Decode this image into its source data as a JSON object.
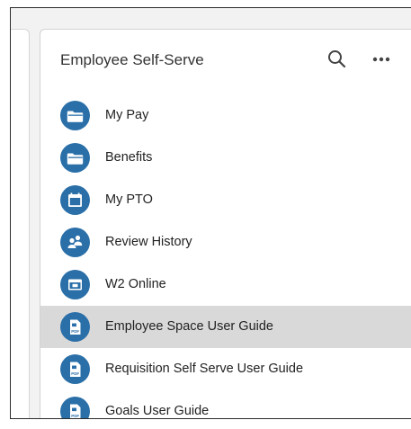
{
  "widget": {
    "title": "Employee Self-Serve",
    "search_icon": "search-icon",
    "more_icon": "more-horizontal-icon"
  },
  "colors": {
    "accent": "#2a6fa8",
    "selected_row": "#d9d9d9",
    "background": "#f2f2f2"
  },
  "items": [
    {
      "label": "My Pay",
      "icon": "folder-icon"
    },
    {
      "label": "Benefits",
      "icon": "folder-icon"
    },
    {
      "label": "My PTO",
      "icon": "calendar-icon"
    },
    {
      "label": "Review History",
      "icon": "people-icon"
    },
    {
      "label": "W2 Online",
      "icon": "window-icon"
    },
    {
      "label": "Employee Space User Guide",
      "icon": "pdf-icon",
      "selected": true
    },
    {
      "label": "Requisition Self Serve User Guide",
      "icon": "pdf-icon"
    },
    {
      "label": "Goals User Guide",
      "icon": "pdf-icon"
    }
  ]
}
